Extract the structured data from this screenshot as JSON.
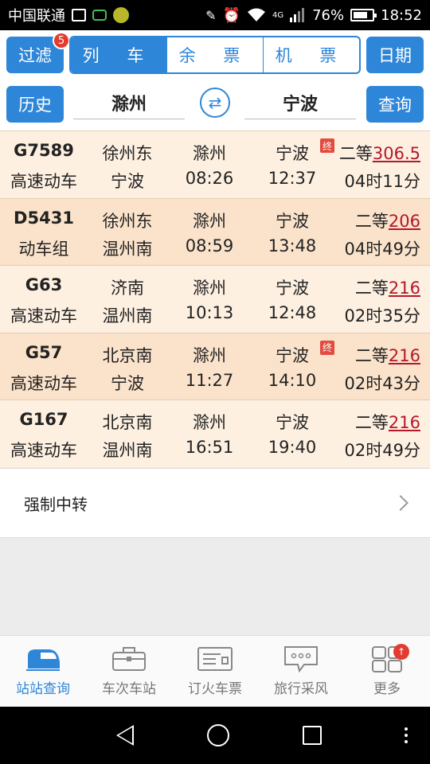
{
  "status_bar": {
    "carrier": "中国联通",
    "network": "4G",
    "battery": "76%",
    "battery_level": 0.76,
    "time": "18:52"
  },
  "toolbar": {
    "filter_label": "过滤",
    "filter_badge": "5",
    "tabs": [
      {
        "label": "列 车",
        "active": true
      },
      {
        "label": "余 票",
        "active": false
      },
      {
        "label": "机 票",
        "active": false
      }
    ],
    "date_label": "日期",
    "history_label": "历史",
    "from_station": "滁州",
    "swap_icon": "⇄",
    "to_station": "宁波",
    "query_label": "查询"
  },
  "trains": [
    {
      "no": "G7589",
      "type": "高速动车",
      "start": "徐州东",
      "end": "宁波",
      "from": "滁州",
      "to": "宁波",
      "dep": "08:26",
      "arr": "12:37",
      "seat": "二等",
      "price": "306.5",
      "duration": "04时11分",
      "terminal_badge": "终"
    },
    {
      "no": "D5431",
      "type": "动车组",
      "start": "徐州东",
      "end": "温州南",
      "from": "滁州",
      "to": "宁波",
      "dep": "08:59",
      "arr": "13:48",
      "seat": "二等",
      "price": "206",
      "duration": "04时49分",
      "terminal_badge": ""
    },
    {
      "no": "G63",
      "type": "高速动车",
      "start": "济南",
      "end": "温州南",
      "from": "滁州",
      "to": "宁波",
      "dep": "10:13",
      "arr": "12:48",
      "seat": "二等",
      "price": "216",
      "duration": "02时35分",
      "terminal_badge": ""
    },
    {
      "no": "G57",
      "type": "高速动车",
      "start": "北京南",
      "end": "宁波",
      "from": "滁州",
      "to": "宁波",
      "dep": "11:27",
      "arr": "14:10",
      "seat": "二等",
      "price": "216",
      "duration": "02时43分",
      "terminal_badge": "终"
    },
    {
      "no": "G167",
      "type": "高速动车",
      "start": "北京南",
      "end": "温州南",
      "from": "滁州",
      "to": "宁波",
      "dep": "16:51",
      "arr": "19:40",
      "seat": "二等",
      "price": "216",
      "duration": "02时49分",
      "terminal_badge": ""
    }
  ],
  "transfer_label": "强制中转",
  "bottom_nav": [
    {
      "label": "站站查询",
      "icon": "train-front-icon",
      "active": true
    },
    {
      "label": "车次车站",
      "icon": "briefcase-icon",
      "active": false
    },
    {
      "label": "订火车票",
      "icon": "ticket-icon",
      "active": false
    },
    {
      "label": "旅行采风",
      "icon": "chat-bubble-icon",
      "active": false
    },
    {
      "label": "更多",
      "icon": "grid-icon",
      "active": false,
      "badge": "↑"
    }
  ],
  "colors": {
    "accent": "#2e86d9",
    "row_odd": "#fdf0e1",
    "row_even": "#fbe3cb",
    "price": "#b3182b",
    "badge": "#e33b2f"
  }
}
